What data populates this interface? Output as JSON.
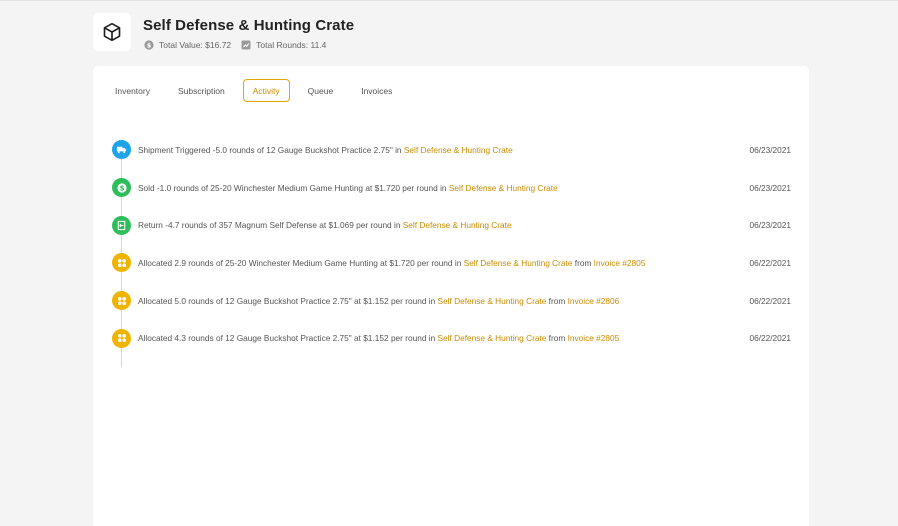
{
  "header": {
    "title": "Self Defense & Hunting Crate",
    "total_value": "Total Value: $16.72",
    "total_rounds": "Total Rounds: 11.4"
  },
  "tabs": [
    {
      "label": "Inventory",
      "active": false
    },
    {
      "label": "Subscription",
      "active": false
    },
    {
      "label": "Activity",
      "active": true
    },
    {
      "label": "Queue",
      "active": false
    },
    {
      "label": "Invoices",
      "active": false
    }
  ],
  "colors": {
    "accent": "#c98c00",
    "shipment": "#1ca3e8",
    "sold": "#2dbd5a",
    "return": "#2dbd5a",
    "allocated": "#f0b400"
  },
  "activity": [
    {
      "type": "shipment",
      "icon": "truck-icon",
      "text": "Shipment Triggered -5.0 rounds of 12 Gauge Buckshot Practice 2.75\" in ",
      "crate_link": "Self Defense & Hunting Crate",
      "date": "06/23/2021"
    },
    {
      "type": "sold",
      "icon": "dollar-icon",
      "text": "Sold -1.0 rounds of 25-20 Winchester Medium Game Hunting at $1.720 per round in ",
      "crate_link": "Self Defense & Hunting Crate",
      "date": "06/23/2021"
    },
    {
      "type": "return",
      "icon": "return-icon",
      "text": "Return -4.7 rounds of 357 Magnum Self Defense at $1.069 per round in ",
      "crate_link": "Self Defense & Hunting Crate",
      "date": "06/23/2021"
    },
    {
      "type": "allocated",
      "icon": "grid-icon",
      "text": "Allocated 2.9 rounds of 25-20 Winchester Medium Game Hunting at $1.720 per round in ",
      "crate_link": "Self Defense & Hunting Crate",
      "from_text": " from ",
      "invoice_link": "Invoice #2805",
      "date": "06/22/2021"
    },
    {
      "type": "allocated",
      "icon": "grid-icon",
      "text": "Allocated 5.0 rounds of 12 Gauge Buckshot Practice 2.75\" at $1.152 per round in ",
      "crate_link": "Self Defense & Hunting Crate",
      "from_text": " from ",
      "invoice_link": "Invoice #2806",
      "date": "06/22/2021"
    },
    {
      "type": "allocated",
      "icon": "grid-icon",
      "text": "Allocated 4.3 rounds of 12 Gauge Buckshot Practice 2.75\" at $1.152 per round in ",
      "crate_link": "Self Defense & Hunting Crate",
      "from_text": " from ",
      "invoice_link": "Invoice #2805",
      "date": "06/22/2021"
    }
  ]
}
